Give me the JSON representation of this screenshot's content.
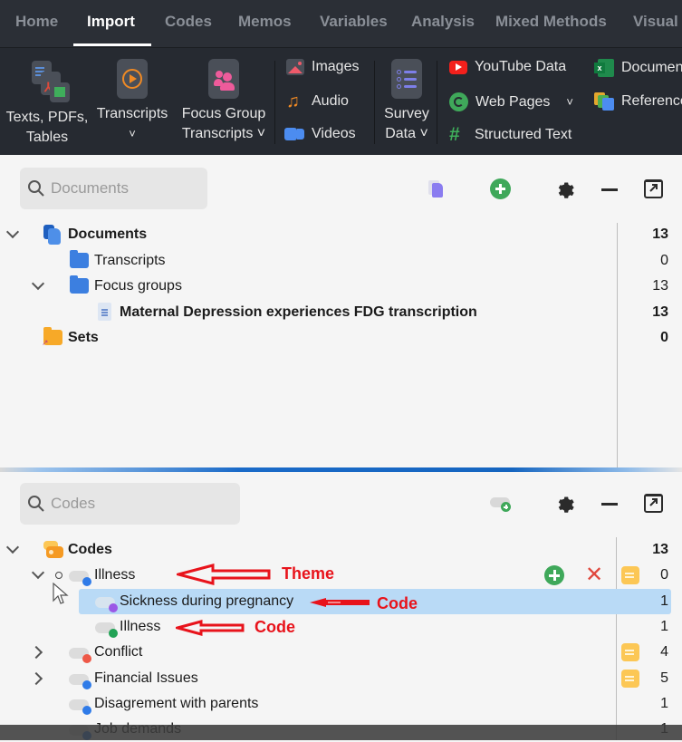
{
  "menu": {
    "tabs": [
      {
        "label": "Home"
      },
      {
        "label": "Import",
        "active": true
      },
      {
        "label": "Codes"
      },
      {
        "label": "Memos"
      },
      {
        "label": "Variables"
      },
      {
        "label": "Analysis"
      },
      {
        "label": "Mixed Methods"
      },
      {
        "label": "Visual"
      }
    ]
  },
  "ribbon": {
    "texts_pdfs_tables": {
      "line1": "Texts, PDFs,",
      "line2": "Tables"
    },
    "transcripts": {
      "label": "Transcripts",
      "dropdown": "˅"
    },
    "focus_group": {
      "line1": "Focus Group",
      "line2": "Transcripts ˅"
    },
    "images": "Images",
    "audio": "Audio",
    "videos": "Videos",
    "survey": {
      "line1": "Survey",
      "line2": "Data ˅"
    },
    "youtube": "YouTube Data",
    "web_pages": "Web Pages",
    "web_pages_dropdown": "˅",
    "structured_text": "Structured Text",
    "documents": "Documents",
    "references": "References"
  },
  "documents_panel": {
    "search_placeholder": "Documents",
    "tree": [
      {
        "label": "Documents",
        "count": "13",
        "bold": true
      },
      {
        "label": "Transcripts",
        "count": "0"
      },
      {
        "label": "Focus groups",
        "count": "13"
      },
      {
        "label": "Maternal Depression experiences FDG transcription",
        "count": "13",
        "bold": true
      },
      {
        "label": "Sets",
        "count": "0",
        "bold": true
      }
    ]
  },
  "codes_panel": {
    "search_placeholder": "Codes",
    "tree": [
      {
        "label": "Codes",
        "count": "13",
        "bold": true
      },
      {
        "label": "Illness",
        "count": "0",
        "color": "#2f7be8"
      },
      {
        "label": "Sickness during pregnancy",
        "count": "1",
        "color": "#9b59e6",
        "selected": true
      },
      {
        "label": "Illness",
        "count": "1",
        "color": "#22a356"
      },
      {
        "label": "Conflict",
        "count": "4",
        "color": "#ee5847"
      },
      {
        "label": "Financial Issues",
        "count": "5",
        "color": "#2f7be8"
      },
      {
        "label": "Disagrement with parents",
        "count": "1",
        "color": "#2f7be8"
      },
      {
        "label": "Job demands",
        "count": "1",
        "color": "#2f7be8"
      }
    ]
  },
  "annotations": {
    "theme": "Theme",
    "code1": "Code",
    "code2": "Code"
  },
  "colors": {
    "accent_blue": "#1565c0",
    "selected_row": "#b9daf6",
    "annotation_red": "#e8131b"
  }
}
